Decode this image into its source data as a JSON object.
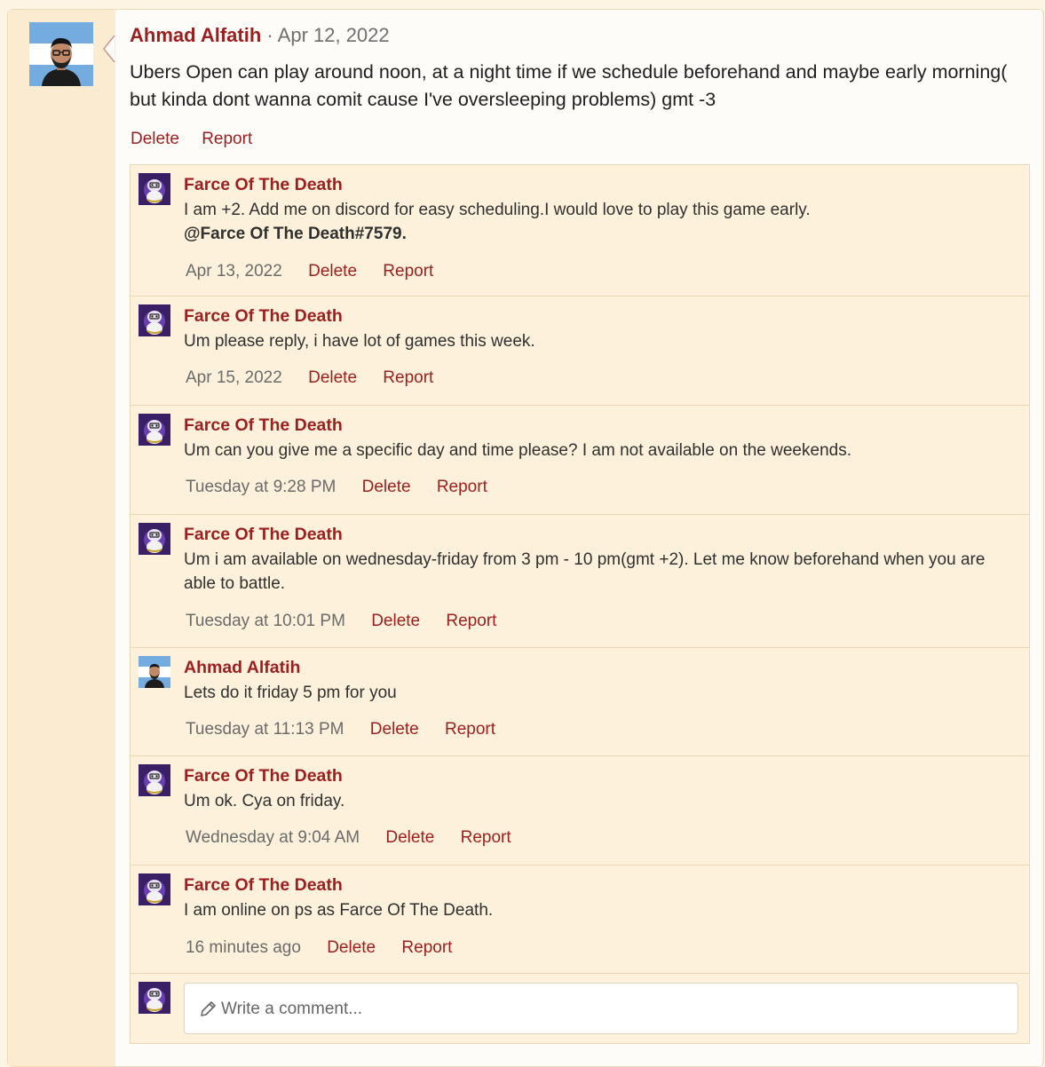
{
  "post": {
    "author": "Ahmad Alfatih",
    "separator": "·",
    "date": "Apr 12, 2022",
    "body": "Ubers Open can play around noon, at a night time if we schedule beforehand and maybe early morning( but kinda dont wanna comit cause I've oversleeping problems) gmt -3",
    "actions": {
      "delete": "Delete",
      "report": "Report"
    }
  },
  "comments": [
    {
      "author": "Farce Of The Death",
      "avatar": "dragonite-avatar",
      "text": "I am +2. Add me on discord for easy scheduling.I would love to play this game early.",
      "extra": "@Farce Of The Death#7579.",
      "date": "Apr 13, 2022",
      "delete": "Delete",
      "report": "Report"
    },
    {
      "author": "Farce Of The Death",
      "avatar": "dragonite-avatar",
      "text": "Um please reply, i have lot of games this week.",
      "date": "Apr 15, 2022",
      "delete": "Delete",
      "report": "Report"
    },
    {
      "author": "Farce Of The Death",
      "avatar": "dragonite-avatar",
      "text": "Um can you give me a specific day and time please? I am not available on the weekends.",
      "date": "Tuesday at 9:28 PM",
      "delete": "Delete",
      "report": "Report"
    },
    {
      "author": "Farce Of The Death",
      "avatar": "dragonite-avatar",
      "text": "Um i am available on wednesday-friday from 3 pm - 10 pm(gmt +2). Let me know beforehand when you are able to battle.",
      "date": "Tuesday at 10:01 PM",
      "delete": "Delete",
      "report": "Report"
    },
    {
      "author": "Ahmad Alfatih",
      "avatar": "ahmad-avatar",
      "text": "Lets do it friday 5 pm for you",
      "date": "Tuesday at 11:13 PM",
      "delete": "Delete",
      "report": "Report"
    },
    {
      "author": "Farce Of The Death",
      "avatar": "dragonite-avatar",
      "text": "Um ok. Cya on friday.",
      "date": "Wednesday at 9:04 AM",
      "delete": "Delete",
      "report": "Report"
    },
    {
      "author": "Farce Of The Death",
      "avatar": "dragonite-avatar",
      "text": "I am online on ps as Farce Of The Death.",
      "date": "16 minutes ago",
      "delete": "Delete",
      "report": "Report"
    }
  ],
  "composer": {
    "placeholder": "Write a comment...",
    "icon": "pencil-icon"
  },
  "colors": {
    "accent": "#9c1f1f",
    "panel": "#fdf1db",
    "border": "#ead6b0",
    "sidebar": "#fbebd0"
  }
}
